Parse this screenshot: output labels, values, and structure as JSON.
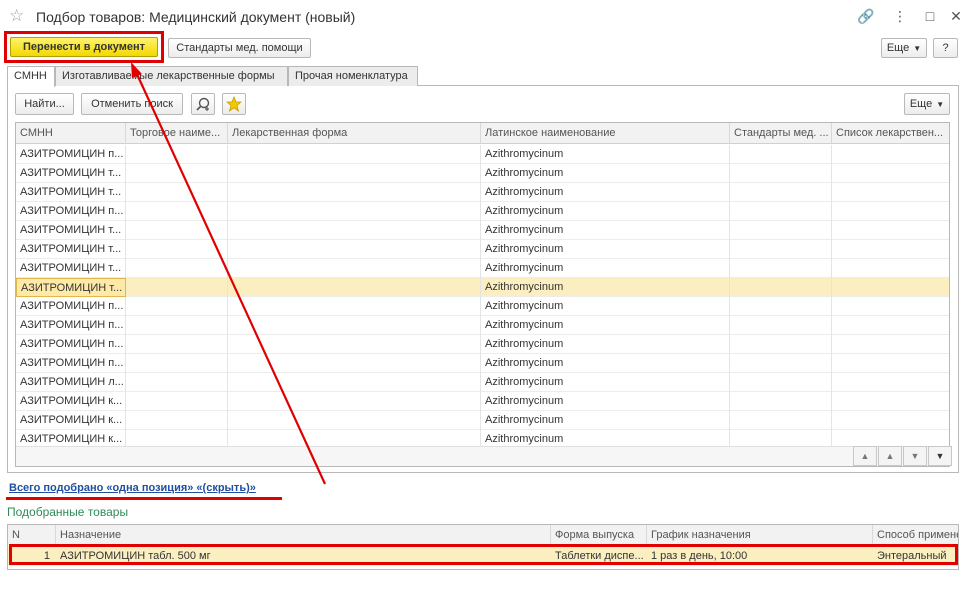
{
  "window": {
    "title": "Подбор товаров: Медицинский документ (новый)",
    "controls": {
      "link": "🔗",
      "menu": "⋮",
      "minimize": "–",
      "maximize": "□",
      "close": "✕"
    }
  },
  "toolbar": {
    "transfer_label": "Перенести в документ",
    "standards_label": "Стандарты мед. помощи",
    "more_label": "Еще",
    "help_label": "?"
  },
  "tabs": [
    {
      "label": "СМНН"
    },
    {
      "label": "Изготавливаемые лекарственные формы"
    },
    {
      "label": "Прочая номенклатура"
    }
  ],
  "grid_toolbar": {
    "find_label": "Найти...",
    "cancel_search_label": "Отменить поиск",
    "more_label": "Еще"
  },
  "grid": {
    "columns": [
      "СМНН",
      "Торговое наиме...",
      "Лекарственная форма",
      "Латинское наименование",
      "Стандарты мед. ...",
      "Список лекарствен..."
    ],
    "rows": [
      [
        "АЗИТРОМИЦИН п...",
        "",
        "",
        "Azithromycinum",
        "",
        ""
      ],
      [
        "АЗИТРОМИЦИН т...",
        "",
        "",
        "Azithromycinum",
        "",
        ""
      ],
      [
        "АЗИТРОМИЦИН т...",
        "",
        "",
        "Azithromycinum",
        "",
        ""
      ],
      [
        "АЗИТРОМИЦИН п...",
        "",
        "",
        "Azithromycinum",
        "",
        ""
      ],
      [
        "АЗИТРОМИЦИН т...",
        "",
        "",
        "Azithromycinum",
        "",
        ""
      ],
      [
        "АЗИТРОМИЦИН т...",
        "",
        "",
        "Azithromycinum",
        "",
        ""
      ],
      [
        "АЗИТРОМИЦИН т...",
        "",
        "",
        "Azithromycinum",
        "",
        ""
      ],
      [
        "АЗИТРОМИЦИН т...",
        "",
        "",
        "Azithromycinum",
        "",
        ""
      ],
      [
        "АЗИТРОМИЦИН п...",
        "",
        "",
        "Azithromycinum",
        "",
        ""
      ],
      [
        "АЗИТРОМИЦИН п...",
        "",
        "",
        "Azithromycinum",
        "",
        ""
      ],
      [
        "АЗИТРОМИЦИН п...",
        "",
        "",
        "Azithromycinum",
        "",
        ""
      ],
      [
        "АЗИТРОМИЦИН п...",
        "",
        "",
        "Azithromycinum",
        "",
        ""
      ],
      [
        "АЗИТРОМИЦИН л...",
        "",
        "",
        "Azithromycinum",
        "",
        ""
      ],
      [
        "АЗИТРОМИЦИН к...",
        "",
        "",
        "Azithromycinum",
        "",
        ""
      ],
      [
        "АЗИТРОМИЦИН к...",
        "",
        "",
        "Azithromycinum",
        "",
        ""
      ],
      [
        "АЗИТРОМИЦИН к...",
        "",
        "",
        "Azithromycinum",
        "",
        ""
      ],
      [
        "",
        "",
        "",
        "Azithromycinum",
        "",
        ""
      ]
    ],
    "selected_row": 7
  },
  "summary_link": "Всего подобрано «одна позиция» «(скрыть)»",
  "selected_goods": {
    "title": "Подобранные товары",
    "columns": [
      "N",
      "Назначение",
      "Форма выпуска",
      "График назначения",
      "Способ примене"
    ],
    "rows": [
      [
        "1",
        "АЗИТРОМИЦИН табл. 500 мг",
        "Таблетки диспе...",
        "1 раз в день, 10:00",
        "Энтеральный"
      ]
    ]
  },
  "colors": {
    "accent_yellow": "#f2d800",
    "annotation_red": "#e00000",
    "link_blue": "#1f4fa0",
    "title_green": "#2e8b57",
    "selected_row": "#fbefc2"
  }
}
